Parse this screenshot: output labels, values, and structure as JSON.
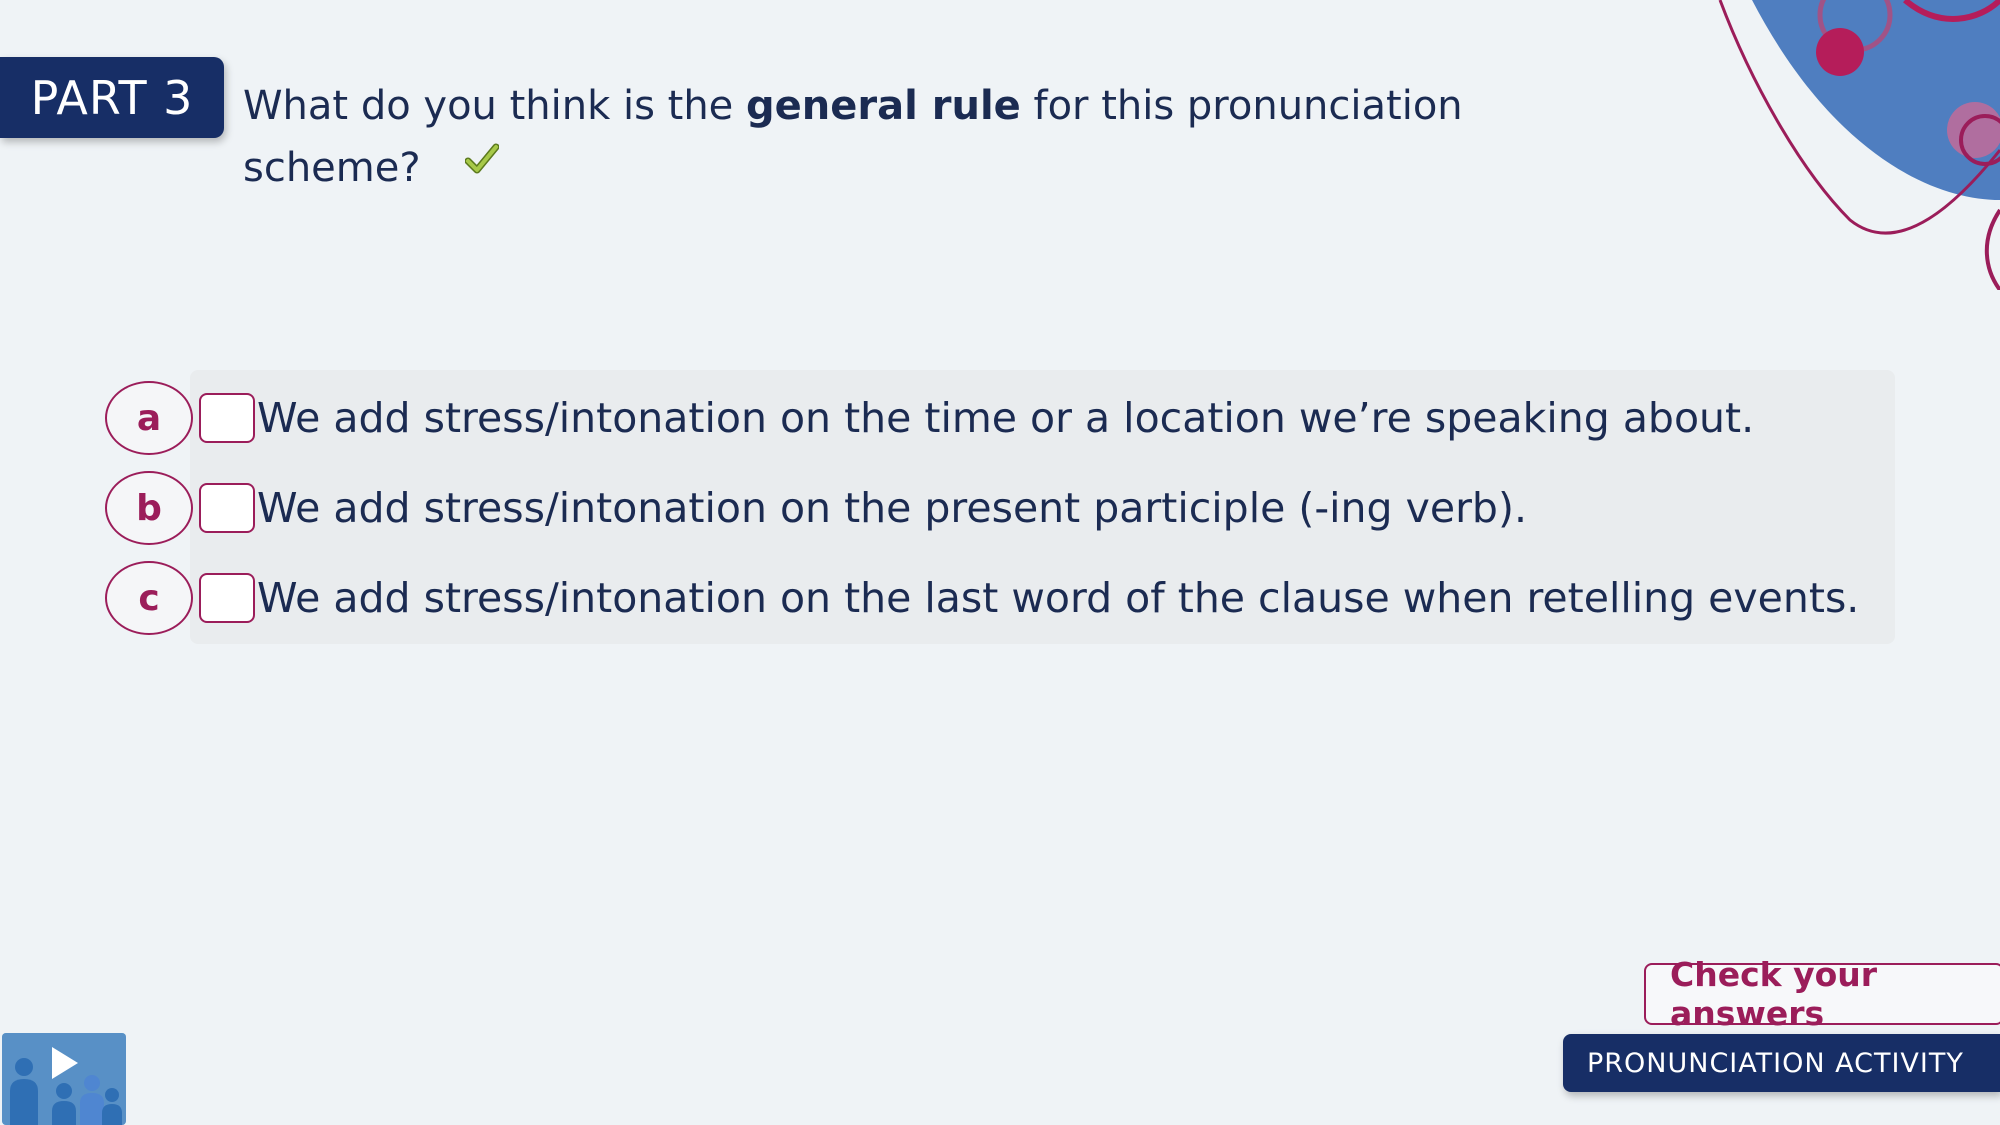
{
  "badge": {
    "label": "PART 3"
  },
  "question": {
    "prefix": "What do you think is the ",
    "bold": "general rule",
    "suffix": " for this pronunciation scheme?"
  },
  "options": [
    {
      "letter": "a",
      "text": "We add stress/intonation on the time or a location we’re speaking about."
    },
    {
      "letter": "b",
      "text": "We add stress/intonation on the present participle (-ing verb)."
    },
    {
      "letter": "c",
      "text": "We add stress/intonation on the last word of the clause when retelling events."
    }
  ],
  "check_button": {
    "label": "Check your answers"
  },
  "footer_tag": {
    "label": "PRONUNCIATION ACTIVITY"
  },
  "icons": {
    "check": "checkmark-icon",
    "class_activity": "group-video-icon",
    "decoration": "decorative-circles"
  },
  "colors": {
    "navy": "#172e66",
    "magenta": "#9b1d5a",
    "blue_deco": "#4f7ec0",
    "background": "#eff3f6",
    "check_green": "#8bb130"
  }
}
